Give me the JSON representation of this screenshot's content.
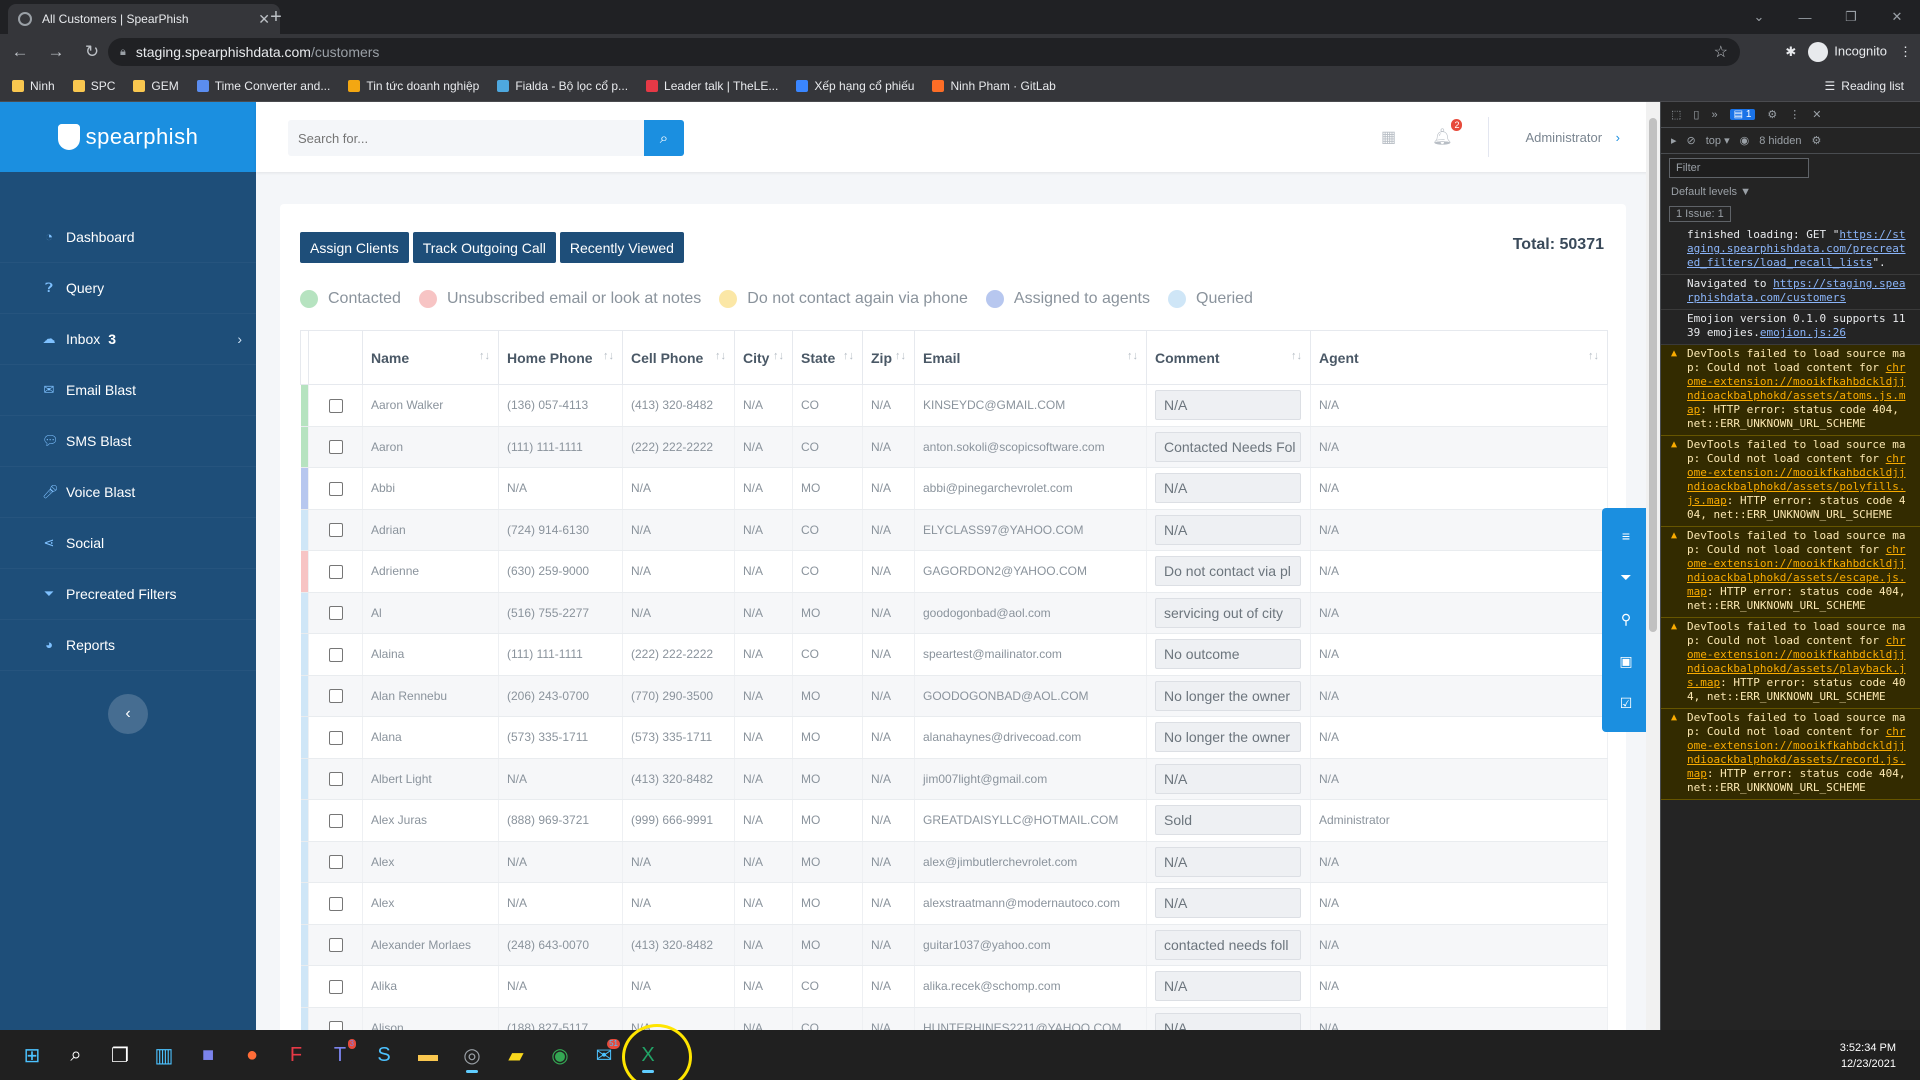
{
  "browser": {
    "tab_title": "All Customers | SpearPhish",
    "url_host": "staging.spearphishdata.com",
    "url_path": "/customers",
    "profile": "Incognito",
    "bookmarks": [
      "Ninh",
      "SPC",
      "GEM",
      "Time Converter and...",
      "Tin tức doanh nghiệp",
      "Fialda - Bộ lọc cổ p...",
      "Leader talk | TheLE...",
      "Xếp hạng cổ phiếu",
      "Ninh Pham · GitLab"
    ],
    "reading_list": "Reading list"
  },
  "app": {
    "brand": "spearphish",
    "search_placeholder": "Search for...",
    "notif_count": "2",
    "user": "Administrator",
    "nav": [
      {
        "label": "Dashboard",
        "icon": "dashboard-icon"
      },
      {
        "label": "Query",
        "icon": "question-icon"
      },
      {
        "label": "Inbox",
        "badge": "3",
        "icon": "inbox-icon"
      },
      {
        "label": "Email Blast",
        "icon": "envelope-icon"
      },
      {
        "label": "SMS Blast",
        "icon": "chat-icon"
      },
      {
        "label": "Voice Blast",
        "icon": "microphone-icon"
      },
      {
        "label": "Social",
        "icon": "share-icon"
      },
      {
        "label": "Precreated Filters",
        "icon": "filter-icon"
      },
      {
        "label": "Reports",
        "icon": "pie-chart-icon"
      }
    ],
    "actions": [
      "Assign Clients",
      "Track Outgoing Call",
      "Recently Viewed"
    ],
    "total": "Total: 50371",
    "legend": [
      {
        "label": "Contacted",
        "color": "#b6e3c0"
      },
      {
        "label": "Unsubscribed email or look at notes",
        "color": "#f7c4c4"
      },
      {
        "label": "Do not contact again via phone",
        "color": "#fbe7a6"
      },
      {
        "label": "Assigned to agents",
        "color": "#b7c7ef"
      },
      {
        "label": "Queried",
        "color": "#cfe6f7"
      }
    ],
    "columns": [
      "Name",
      "Home Phone",
      "Cell Phone",
      "City",
      "State",
      "Zip",
      "Email",
      "Comment",
      "Agent"
    ],
    "rows": [
      {
        "mark": "#b6e3c0",
        "name": "Aaron Walker",
        "home": "(136) 057-4113",
        "cell": "(413) 320-8482",
        "city": "N/A",
        "state": "CO",
        "zip": "N/A",
        "email": "KINSEYDC@GMAIL.COM",
        "comment": "N/A",
        "agent": "N/A"
      },
      {
        "mark": "#b6e3c0",
        "name": "Aaron",
        "home": "(111) 111-1111",
        "cell": "(222) 222-2222",
        "city": "N/A",
        "state": "CO",
        "zip": "N/A",
        "email": "anton.sokoli@scopicsoftware.com",
        "comment": "Contacted Needs Fol",
        "agent": "N/A"
      },
      {
        "mark": "#b7c7ef",
        "name": "Abbi",
        "home": "N/A",
        "cell": "N/A",
        "city": "N/A",
        "state": "MO",
        "zip": "N/A",
        "email": "abbi@pinegarchevrolet.com",
        "comment": "N/A",
        "agent": "N/A"
      },
      {
        "mark": "#cfe6f7",
        "name": "Adrian",
        "home": "(724) 914-6130",
        "cell": "N/A",
        "city": "N/A",
        "state": "CO",
        "zip": "N/A",
        "email": "ELYCLASS97@YAHOO.COM",
        "comment": "N/A",
        "agent": "N/A"
      },
      {
        "mark": "#f7c4c4",
        "name": "Adrienne",
        "home": "(630) 259-9000",
        "cell": "N/A",
        "city": "N/A",
        "state": "CO",
        "zip": "N/A",
        "email": "GAGORDON2@YAHOO.COM",
        "comment": "Do not contact via pl",
        "agent": "N/A"
      },
      {
        "mark": "#cfe6f7",
        "name": "Al",
        "home": "(516) 755-2277",
        "cell": "N/A",
        "city": "N/A",
        "state": "MO",
        "zip": "N/A",
        "email": "goodogonbad@aol.com",
        "comment": "servicing out of city",
        "agent": "N/A"
      },
      {
        "mark": "#cfe6f7",
        "name": "Alaina",
        "home": "(111) 111-1111",
        "cell": "(222) 222-2222",
        "city": "N/A",
        "state": "CO",
        "zip": "N/A",
        "email": "speartest@mailinator.com",
        "comment": "No outcome",
        "agent": "N/A"
      },
      {
        "mark": "#cfe6f7",
        "name": "Alan Rennebu",
        "home": "(206) 243-0700",
        "cell": "(770) 290-3500",
        "city": "N/A",
        "state": "MO",
        "zip": "N/A",
        "email": "GOODOGONBAD@AOL.COM",
        "comment": "No longer the owner",
        "agent": "N/A"
      },
      {
        "mark": "#cfe6f7",
        "name": "Alana",
        "home": "(573) 335-1711",
        "cell": "(573) 335-1711",
        "city": "N/A",
        "state": "MO",
        "zip": "N/A",
        "email": "alanahaynes@drivecoad.com",
        "comment": "No longer the owner",
        "agent": "N/A"
      },
      {
        "mark": "#cfe6f7",
        "name": "Albert Light",
        "home": "N/A",
        "cell": "(413) 320-8482",
        "city": "N/A",
        "state": "MO",
        "zip": "N/A",
        "email": "jim007light@gmail.com",
        "comment": "N/A",
        "agent": "N/A"
      },
      {
        "mark": "#cfe6f7",
        "name": "Alex Juras",
        "home": "(888) 969-3721",
        "cell": "(999) 666-9991",
        "city": "N/A",
        "state": "MO",
        "zip": "N/A",
        "email": "GREATDAISYLLC@HOTMAIL.COM",
        "comment": "Sold",
        "agent": "Administrator"
      },
      {
        "mark": "#cfe6f7",
        "name": "Alex",
        "home": "N/A",
        "cell": "N/A",
        "city": "N/A",
        "state": "MO",
        "zip": "N/A",
        "email": "alex@jimbutlerchevrolet.com",
        "comment": "N/A",
        "agent": "N/A"
      },
      {
        "mark": "#cfe6f7",
        "name": "Alex",
        "home": "N/A",
        "cell": "N/A",
        "city": "N/A",
        "state": "MO",
        "zip": "N/A",
        "email": "alexstraatmann@modernautoco.com",
        "comment": "N/A",
        "agent": "N/A"
      },
      {
        "mark": "#cfe6f7",
        "name": "Alexander Morlaes",
        "home": "(248) 643-0070",
        "cell": "(413) 320-8482",
        "city": "N/A",
        "state": "MO",
        "zip": "N/A",
        "email": "guitar1037@yahoo.com",
        "comment": "contacted needs foll",
        "agent": "N/A"
      },
      {
        "mark": "#cfe6f7",
        "name": "Alika",
        "home": "N/A",
        "cell": "N/A",
        "city": "N/A",
        "state": "CO",
        "zip": "N/A",
        "email": "alika.recek@schomp.com",
        "comment": "N/A",
        "agent": "N/A"
      },
      {
        "mark": "#cfe6f7",
        "name": "Alison",
        "home": "(188) 827-5117",
        "cell": "N/A",
        "city": "N/A",
        "state": "CO",
        "zip": "N/A",
        "email": "HUNTERHINES2211@YAHOO.COM",
        "comment": "N/A",
        "agent": "N/A"
      }
    ]
  },
  "devtools": {
    "context": "top",
    "hidden": "8 hidden",
    "msg_count": "1",
    "filter": "Filter",
    "levels": "Default levels ▼",
    "issue": "1 Issue: 1",
    "logs": [
      {
        "type": "info",
        "text": "finished loading: GET \"",
        "link": "https://staging.spearphishdata.com/precreated_filters/load_recall_lists",
        "tail": "\"."
      },
      {
        "type": "info",
        "text": "Navigated to ",
        "link": "https://staging.spearphishdata.com/customers",
        "tail": ""
      },
      {
        "type": "info",
        "text": "Emojion version 0.1.0 supports 1139 emojies.",
        "link": "emojion.js:26",
        "tail": ""
      },
      {
        "type": "warn",
        "text": "DevTools failed to load source map: Could not load content for ",
        "link": "chrome-extension://mooikfkahbdckldjjndioackbalphokd/assets/atoms.js.map",
        "tail": ": HTTP error: status code 404, net::ERR_UNKNOWN_URL_SCHEME"
      },
      {
        "type": "warn",
        "text": "DevTools failed to load source map: Could not load content for ",
        "link": "chrome-extension://mooikfkahbdckldjjndioackbalphokd/assets/polyfills.js.map",
        "tail": ": HTTP error: status code 404, net::ERR_UNKNOWN_URL_SCHEME"
      },
      {
        "type": "warn",
        "text": "DevTools failed to load source map: Could not load content for ",
        "link": "chrome-extension://mooikfkahbdckldjjndioackbalphokd/assets/escape.js.map",
        "tail": ": HTTP error: status code 404, net::ERR_UNKNOWN_URL_SCHEME"
      },
      {
        "type": "warn",
        "text": "DevTools failed to load source map: Could not load content for ",
        "link": "chrome-extension://mooikfkahbdckldjjndioackbalphokd/assets/playback.js.map",
        "tail": ": HTTP error: status code 404, net::ERR_UNKNOWN_URL_SCHEME"
      },
      {
        "type": "warn",
        "text": "DevTools failed to load source map: Could not load content for ",
        "link": "chrome-extension://mooikfkahbdckldjjndioackbalphokd/assets/record.js.map",
        "tail": ": HTTP error: status code 404, net::ERR_UNKNOWN_URL_SCHEME"
      }
    ]
  },
  "taskbar": {
    "time": "3:52:34 PM",
    "date": "12/23/2021",
    "teams_badge": "3",
    "mail_badge": "51"
  }
}
